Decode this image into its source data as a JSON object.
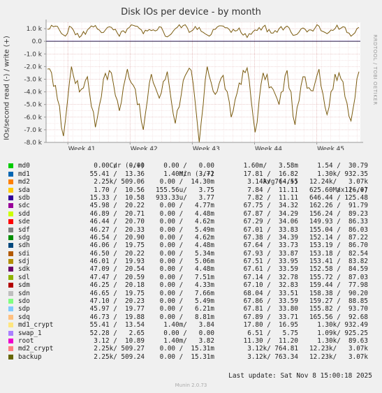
{
  "chart_data": {
    "type": "line",
    "title": "Disk IOs per device - by month",
    "ylabel": "IOs/second read (-) / write (+)",
    "ylim": [
      -8000,
      1500
    ],
    "yticks": [
      {
        "value": 1000,
        "label": "1.0 k"
      },
      {
        "value": 0,
        "label": "0.0"
      },
      {
        "value": -1000,
        "label": "-1.0 k"
      },
      {
        "value": -2000,
        "label": "-2.0 k"
      },
      {
        "value": -3000,
        "label": "-3.0 k"
      },
      {
        "value": -4000,
        "label": "-4.0 k"
      },
      {
        "value": -5000,
        "label": "-5.0 k"
      },
      {
        "value": -6000,
        "label": "-6.0 k"
      },
      {
        "value": -7000,
        "label": "-7.0 k"
      },
      {
        "value": -8000,
        "label": "-8.0 k"
      }
    ],
    "xticks": [
      {
        "value": 0.05,
        "label": "Week 41"
      },
      {
        "value": 1.05,
        "label": "Week 42"
      },
      {
        "value": 2.05,
        "label": "Week 43"
      },
      {
        "value": 3.05,
        "label": "Week 44"
      },
      {
        "value": 4.05,
        "label": "Week 45"
      }
    ],
    "x_range_weeks": [
      -0.3,
      4.75
    ],
    "grid": true,
    "series": [
      {
        "name": "backup",
        "color": "#7a5b0f",
        "write_approx": [
          950,
          1200,
          500,
          1100,
          300,
          900,
          1250,
          700,
          1100,
          400,
          1000,
          1200,
          600,
          850,
          1150,
          350,
          1000,
          1250,
          800,
          1100,
          500,
          950,
          1200,
          700,
          1050,
          300,
          900,
          1150,
          650,
          1000,
          1200,
          500,
          1050,
          900,
          1200,
          600,
          1000,
          1150,
          400,
          1100
        ],
        "read_approx": [
          -2200,
          -3500,
          -7500,
          -2000,
          -4000,
          -2800,
          -6800,
          -3000,
          -2500,
          -5500,
          -2200,
          -3800,
          -7000,
          -2600,
          -4500,
          -2400,
          -6500,
          -3100,
          -2300,
          -8000,
          -2000,
          -4200,
          -2700,
          -6000,
          -3300,
          -2100,
          -7200,
          -2500,
          -3600,
          -5000,
          -2300,
          -6600,
          -2800,
          -3900,
          -2200,
          -5800,
          -2600,
          -3200,
          -6300,
          -2400
        ]
      }
    ]
  },
  "side_label": "RRDTOOL / TOBI OETIKER",
  "legend": {
    "headers": [
      "Cur (-/+)",
      "Min (-/+)",
      "Avg (-/+)",
      "Max (-/+)"
    ],
    "rows": [
      {
        "name": "md0",
        "color": "#00cc00",
        "cur": "0.00 /   0.00",
        "min": "0.00 /   0.00",
        "avg": "1.60m/   3.58m",
        "max": "1.54 /  30.79"
      },
      {
        "name": "md1",
        "color": "#0066b3",
        "cur": "55.41 /  13.36",
        "min": "1.40m/   3.72",
        "avg": "17.81 /  16.82",
        "max": "1.30k/ 932.35"
      },
      {
        "name": "md2",
        "color": "#ff8000",
        "cur": "2.25k/ 509.06",
        "min": "0.00 /  14.30m",
        "avg": "3.14k/ 764.55",
        "max": "12.24k/   3.07k"
      },
      {
        "name": "sda",
        "color": "#ffcc00",
        "cur": "1.70 /  10.56",
        "min": "155.56u/   3.75",
        "avg": "7.84 /  11.11",
        "max": "625.60 / 126.07"
      },
      {
        "name": "sdb",
        "color": "#330099",
        "cur": "15.33 /  10.58",
        "min": "933.33u/   3.77",
        "avg": "7.82 /  11.11",
        "max": "646.44 / 125.48"
      },
      {
        "name": "sdc",
        "color": "#990099",
        "cur": "45.98 /  20.22",
        "min": "0.00 /   4.77m",
        "avg": "67.75 /  34.32",
        "max": "162.26 /  91.79"
      },
      {
        "name": "sdd",
        "color": "#ccff00",
        "cur": "46.89 /  20.71",
        "min": "0.00 /   4.48m",
        "avg": "67.87 /  34.29",
        "max": "156.24 /  89.23"
      },
      {
        "name": "sde",
        "color": "#ff0000",
        "cur": "46.44 /  20.70",
        "min": "0.00 /   4.62m",
        "avg": "67.29 /  34.06",
        "max": "149.93 /  86.33"
      },
      {
        "name": "sdf",
        "color": "#808080",
        "cur": "46.27 /  20.33",
        "min": "0.00 /   5.49m",
        "avg": "67.01 /  33.83",
        "max": "155.04 /  86.03"
      },
      {
        "name": "sdg",
        "color": "#008f00",
        "cur": "46.54 /  20.90",
        "min": "0.00 /   4.62m",
        "avg": "67.38 /  34.39",
        "max": "152.14 /  87.22"
      },
      {
        "name": "sdh",
        "color": "#00487d",
        "cur": "46.06 /  19.75",
        "min": "0.00 /   4.48m",
        "avg": "67.64 /  33.73",
        "max": "153.19 /  86.70"
      },
      {
        "name": "sdi",
        "color": "#b35a00",
        "cur": "46.50 /  20.22",
        "min": "0.00 /   5.34m",
        "avg": "67.93 /  33.87",
        "max": "153.18 /  82.54"
      },
      {
        "name": "sdj",
        "color": "#b38f00",
        "cur": "46.01 /  19.93",
        "min": "0.00 /   5.06m",
        "avg": "67.51 /  33.95",
        "max": "153.41 /  83.82"
      },
      {
        "name": "sdk",
        "color": "#6b006b",
        "cur": "47.09 /  20.54",
        "min": "0.00 /   4.48m",
        "avg": "67.61 /  33.59",
        "max": "152.58 /  84.59"
      },
      {
        "name": "sdl",
        "color": "#8fb300",
        "cur": "47.47 /  20.59",
        "min": "0.00 /   7.51m",
        "avg": "67.14 /  32.78",
        "max": "155.72 /  87.03"
      },
      {
        "name": "sdm",
        "color": "#b30000",
        "cur": "46.25 /  20.18",
        "min": "0.00 /   4.33m",
        "avg": "67.10 /  32.83",
        "max": "159.44 /  77.98"
      },
      {
        "name": "sdn",
        "color": "#bebebe",
        "cur": "46.65 /  19.75",
        "min": "0.00 /   7.66m",
        "avg": "68.04 /  33.51",
        "max": "158.38 /  90.20"
      },
      {
        "name": "sdo",
        "color": "#80ff80",
        "cur": "47.10 /  20.23",
        "min": "0.00 /   5.49m",
        "avg": "67.86 /  33.59",
        "max": "159.27 /  88.85"
      },
      {
        "name": "sdp",
        "color": "#80c9ff",
        "cur": "45.97 /  19.77",
        "min": "0.00 /   6.21m",
        "avg": "67.81 /  33.80",
        "max": "155.82 /  93.70"
      },
      {
        "name": "sdq",
        "color": "#ffc080",
        "cur": "46.73 /  19.88",
        "min": "0.00 /   8.81m",
        "avg": "67.89 /  33.71",
        "max": "165.56 /  92.68"
      },
      {
        "name": "md1_crypt",
        "color": "#ffe680",
        "cur": "55.41 /  13.54",
        "min": "1.40m/   3.84",
        "avg": "17.80 /  16.95",
        "max": "1.30k/ 932.49"
      },
      {
        "name": "swap_1",
        "color": "#aa80ff",
        "cur": "52.28 /   2.65",
        "min": "0.00 /   0.00",
        "avg": "6.51 /   5.75",
        "max": "1.09k/ 925.25"
      },
      {
        "name": "root",
        "color": "#ee00cc",
        "cur": "3.12 /  10.89",
        "min": "1.40m/   3.82",
        "avg": "11.30 /  11.20",
        "max": "1.30k/  89.63"
      },
      {
        "name": "md2_crypt",
        "color": "#ff8080",
        "cur": "2.25k/ 509.27",
        "min": "0.00 /  15.31m",
        "avg": "3.12k/ 764.81",
        "max": "12.23k/   3.07k"
      },
      {
        "name": "backup",
        "color": "#666600",
        "cur": "2.25k/ 509.24",
        "min": "0.00 /  15.31m",
        "avg": "3.12k/ 763.34",
        "max": "12.23k/   3.07k"
      }
    ]
  },
  "last_update": "Last update: Sat Nov  8 15:00:18 2025",
  "footer": "Munin 2.0.73"
}
